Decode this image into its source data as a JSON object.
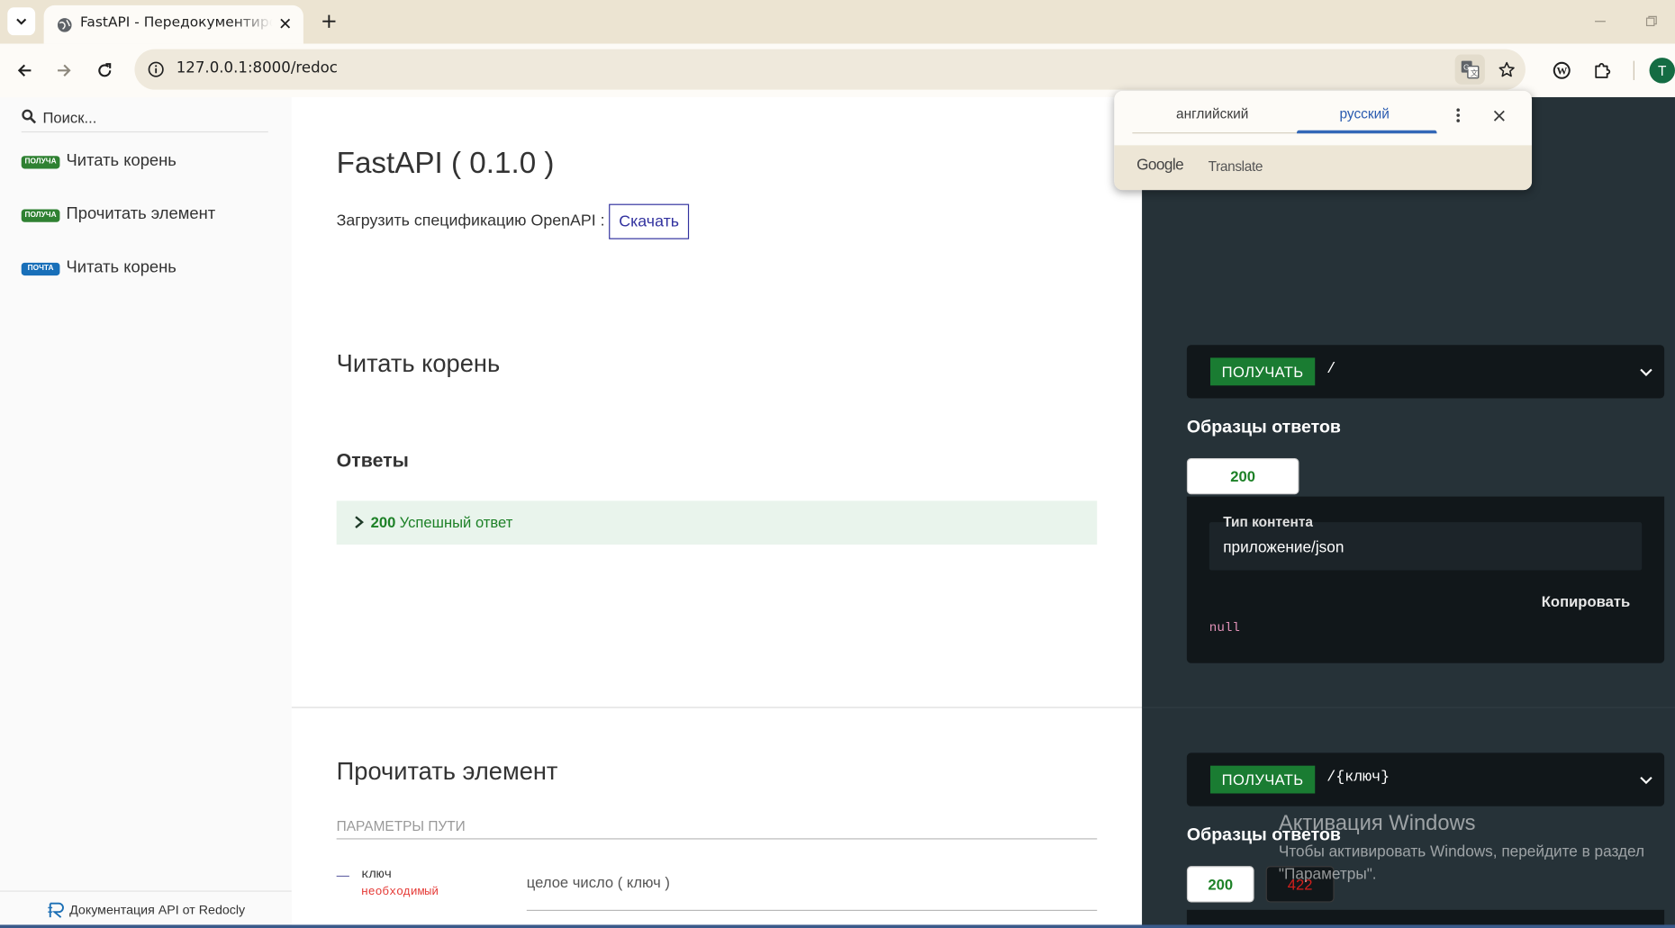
{
  "browser": {
    "tab_title": "FastAPI - Передокументировать",
    "url": "127.0.0.1:8000/redoc",
    "profile_initial": "T"
  },
  "translate_popup": {
    "source_lang": "английский",
    "target_lang": "русский",
    "brand_google": "Google",
    "brand_translate": "Translate"
  },
  "sidebar": {
    "search_placeholder": "Поиск...",
    "items": [
      {
        "badge": "ПОЛУЧА",
        "label": "Читать корень"
      },
      {
        "badge": "ПОЛУЧА",
        "label": "Прочитать элемент"
      },
      {
        "badge": "ПОЧТА",
        "label": "Читать корень"
      }
    ],
    "footer": "Документация API от Redocly"
  },
  "content": {
    "api_title": "FastAPI ( 0.1.0 )",
    "download_label": "Загрузить спецификацию OpenAPI :",
    "download_button": "Скачать",
    "op1": {
      "title": "Читать корень",
      "responses_title": "Ответы",
      "response_code": "200",
      "response_desc": "Успешный ответ"
    },
    "op2": {
      "title": "Прочитать элемент",
      "params_header": "ПАРАМЕТРЫ ПУТИ",
      "param_name": "ключ",
      "param_required": "необходимый",
      "param_type": "целое число ( ключ )"
    }
  },
  "right_panel": {
    "ep1": {
      "method": "ПОЛУЧАТЬ",
      "path": "/",
      "samples_title": "Образцы ответов",
      "status_tabs": [
        "200"
      ],
      "content_type_label": "Тип контента",
      "content_type_value": "приложение/json",
      "copy_label": "Копировать",
      "sample_value": "null"
    },
    "ep2": {
      "method": "ПОЛУЧАТЬ",
      "path": "/{ключ}",
      "samples_title": "Образцы ответов",
      "status_tabs": [
        "200",
        "422"
      ]
    }
  },
  "windows_activation": {
    "title": "Активация Windows",
    "subtitle": "Чтобы активировать Windows, перейдите в раздел \"Параметры\"."
  },
  "colors": {
    "get_badge": "#2f8132",
    "post_badge": "#186fb9",
    "brand_link": "#32329f",
    "right_panel_bg": "#263238",
    "success_green": "#1d8127",
    "error_red": "#d41f1c"
  }
}
